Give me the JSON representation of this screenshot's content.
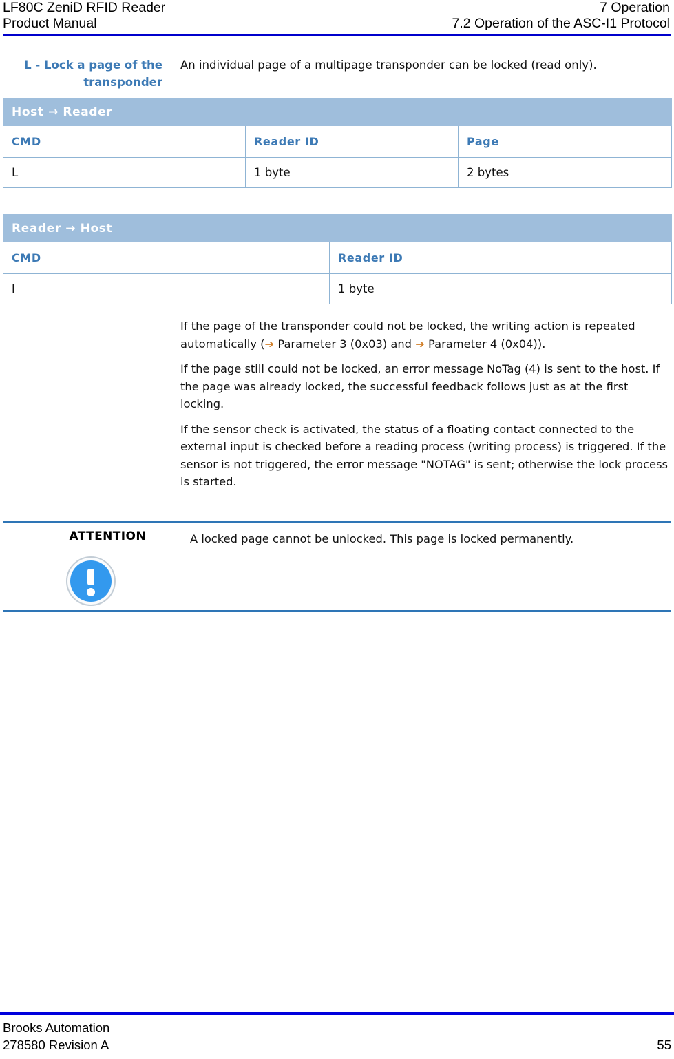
{
  "header": {
    "left_line1": "LF80C ZeniD RFID Reader",
    "left_line2": "Product Manual",
    "right_line1": "7 Operation",
    "right_line2": "7.2 Operation of the ASC-I1 Protocol",
    "rule_color": "#0000cc"
  },
  "section": {
    "heading_line1": "L - Lock a page of the",
    "heading_line2": "transponder",
    "heading_color": "#3d7ab5",
    "intro": "An individual page of a multipage transponder can be locked (read only)."
  },
  "tables": [
    {
      "banner": "Host  → Reader",
      "columns": [
        "CMD",
        "Reader ID",
        "Page"
      ],
      "row": [
        "L",
        "1 byte",
        "2 bytes"
      ]
    },
    {
      "banner": "Reader → Host",
      "columns": [
        "CMD",
        "Reader ID"
      ],
      "row": [
        "l",
        "1 byte"
      ]
    }
  ],
  "body": {
    "para1_a": "If the page of the transponder could not be locked, the writing action is repeated automatically (",
    "para1_arrow1": "➔",
    "para1_b": " Parameter 3 (0x03) and ",
    "para1_arrow2": "➔",
    "para1_c": " Parameter 4 (0x04)).",
    "para2": "If the page still could not be locked, an error message NoTag (4) is sent to the host. If the page was already locked, the successful feedback follows just as at the first locking.",
    "para3": "If the sensor check is activated, the status of a floating contact connected to the external input is checked before a reading process (writing process) is triggered.  If the sensor is not triggered, the error message \"NOTAG\" is sent; otherwise the lock process is started."
  },
  "callout": {
    "label": "ATTENTION",
    "text": "A locked page cannot be unlocked. This page is locked permanently.",
    "icon": "attention-exclamation-icon",
    "rule_color": "#2e75b6",
    "icon_color": "#3399ee"
  },
  "footer": {
    "company": "Brooks Automation",
    "document": "278580 Revision A",
    "page_number": "55",
    "rule_color": "#0000dd"
  }
}
